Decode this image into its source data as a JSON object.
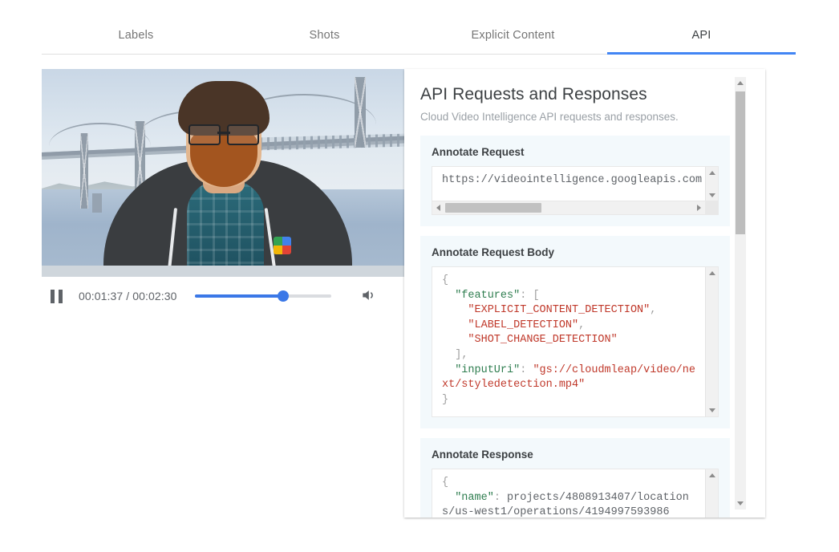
{
  "tabs": [
    {
      "label": "Labels",
      "active": false
    },
    {
      "label": "Shots",
      "active": false
    },
    {
      "label": "Explicit Content",
      "active": false
    },
    {
      "label": "API",
      "active": true
    }
  ],
  "player": {
    "pause_icon": "pause-icon",
    "volume_icon": "volume-icon",
    "current_time": "00:01:37",
    "duration": "00:02:30",
    "time_display": "00:01:37 / 00:02:30",
    "progress_percent": 65,
    "accent_color": "#3b78e7"
  },
  "panel": {
    "title": "API Requests and Responses",
    "subtitle": "Cloud Video Intelligence API requests and responses.",
    "sections": [
      {
        "label": "Annotate Request",
        "text": "https://videointelligence.googleapis.com"
      },
      {
        "label": "Annotate Request Body",
        "text": "{\n  \"features\": [\n    \"EXPLICIT_CONTENT_DETECTION\",\n    \"LABEL_DETECTION\",\n    \"SHOT_CHANGE_DETECTION\"\n  ],\n  \"inputUri\": \"gs://cloudmleap/video/next/styledetection.mp4\"\n}"
      },
      {
        "label": "Annotate Response",
        "text": "{\n  \"name\": \"projects/4808913407/locations/us-west1/operations/4194997593986"
      }
    ]
  },
  "colors": {
    "tab_active_underline": "#4285f4",
    "section_background": "#f3f9fc",
    "code_key": "#2e7d4f",
    "code_string": "#c0392b",
    "code_punct": "#9e9e9e"
  }
}
